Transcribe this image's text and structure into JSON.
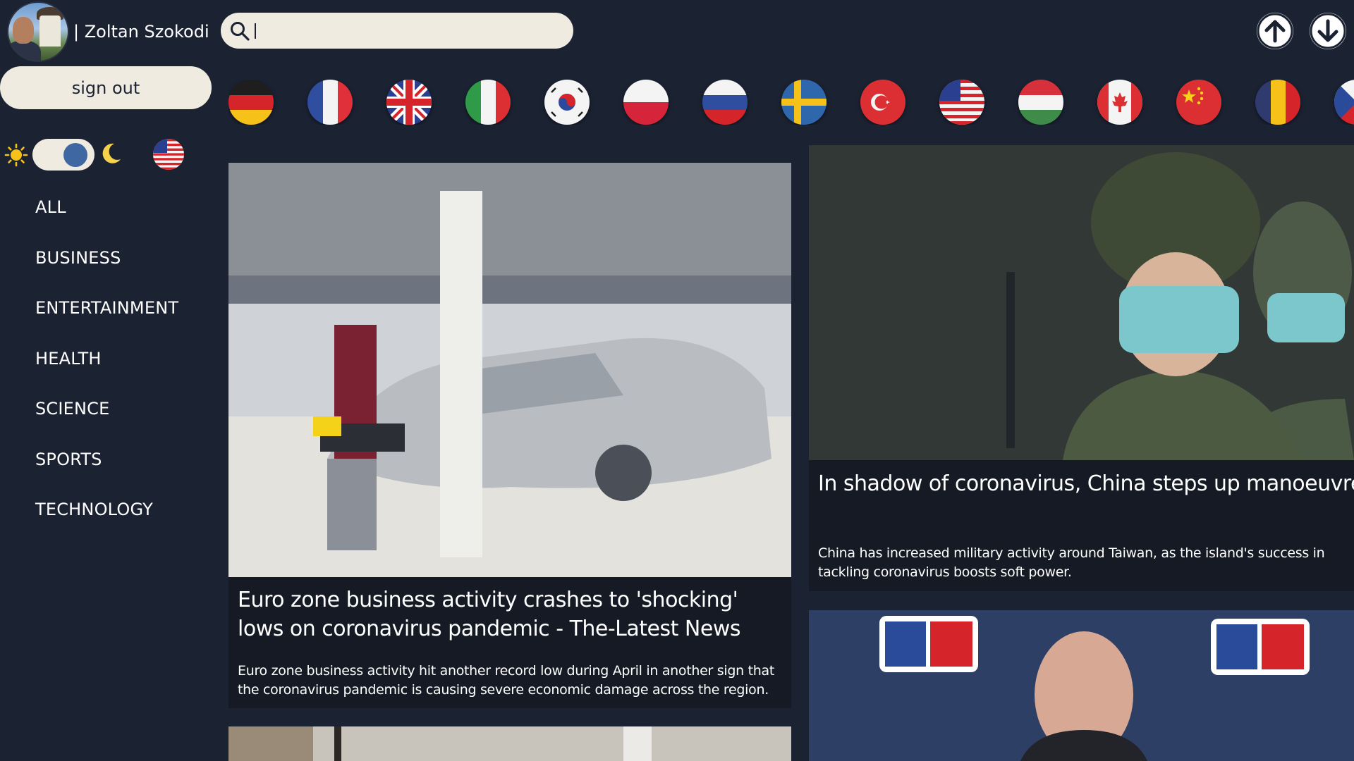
{
  "user": {
    "name": "| Zoltan Szokodi",
    "sign_out_label": "sign out"
  },
  "search": {
    "value": "",
    "placeholder": ""
  },
  "scroll": {
    "up_icon": "arrow-up-icon",
    "down_icon": "arrow-down-icon"
  },
  "countries": [
    "Germany",
    "France",
    "United Kingdom",
    "Italy",
    "South Korea",
    "Poland",
    "Russia",
    "Sweden",
    "Turkey",
    "United States",
    "Hungary",
    "Canada",
    "China",
    "Romania",
    "Czech Republic"
  ],
  "theme": {
    "sun_icon": "sun-icon",
    "moon_icon": "moon-icon",
    "mode": "dark",
    "selected_country": "United States"
  },
  "categories": [
    "ALL",
    "BUSINESS",
    "ENTERTAINMENT",
    "HEALTH",
    "SCIENCE",
    "SPORTS",
    "TECHNOLOGY"
  ],
  "articles": [
    {
      "title": "Euro zone business activity crashes to 'shocking' lows on coronavirus pandemic - The-Latest News",
      "description": "Euro zone business activity hit another record low during April in another sign that the coronavirus pandemic is causing severe economic damage across the region."
    },
    {
      "title": "In shadow of coronavirus, China steps up manoeuvres near Taiwan - Al Jazeera English",
      "description": "China has increased military activity around Taiwan, as the island's success in tackling coronavirus boosts soft power."
    }
  ],
  "colors": {
    "background": "#1b2232",
    "card": "#151a25",
    "pill": "#f0ebe0",
    "accent": "#3f67a2"
  }
}
